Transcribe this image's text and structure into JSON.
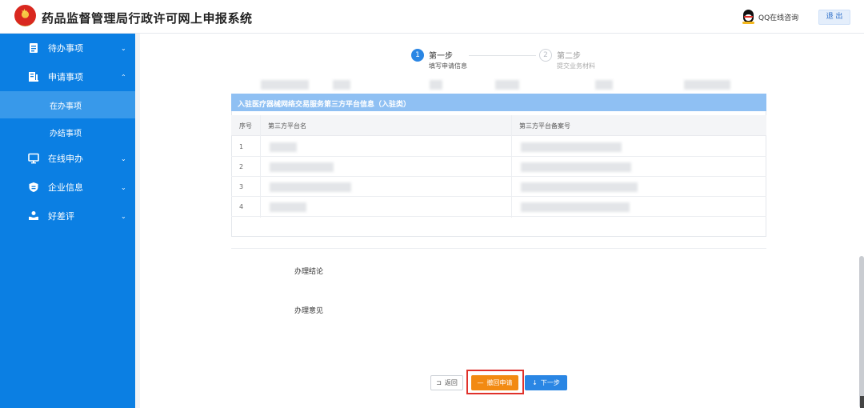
{
  "header": {
    "title": "药品监督管理局行政许可网上申报系统",
    "qq_label": "QQ在线咨询",
    "logout_label": "退 出"
  },
  "sidebar": {
    "items": [
      {
        "label": "待办事项",
        "icon": "todo-list-icon",
        "arrow": "⌄"
      },
      {
        "label": "申请事项",
        "icon": "application-icon",
        "arrow": "⌃"
      },
      {
        "label": "在办事项"
      },
      {
        "label": "办结事项"
      },
      {
        "label": "在线申办",
        "icon": "monitor-icon",
        "arrow": "⌄"
      },
      {
        "label": "企业信息",
        "icon": "shield-icon",
        "arrow": "⌄"
      },
      {
        "label": "好差评",
        "icon": "hand-rating-icon",
        "arrow": "⌄"
      }
    ]
  },
  "steps": [
    {
      "number": "1",
      "title": "第一步",
      "subtitle": "填写申请信息",
      "state": "active"
    },
    {
      "number": "2",
      "title": "第二步",
      "subtitle": "提交业务材料",
      "state": "pending"
    }
  ],
  "table": {
    "title": "入驻医疗器械网络交易服务第三方平台信息（入驻类）",
    "columns": [
      "序号",
      "第三方平台名",
      "第三方平台备案号"
    ],
    "rows": [
      {
        "index": "1"
      },
      {
        "index": "2"
      },
      {
        "index": "3"
      },
      {
        "index": "4"
      }
    ]
  },
  "fields": {
    "conclusion_label": "办理结论",
    "opinion_label": "办理意见"
  },
  "buttons": {
    "back_label": "返回",
    "withdraw_label": "撤回申请",
    "next_label": "下一步"
  },
  "colors": {
    "sidebar": "#0b7fe3",
    "sidebar_active": "#3899ea",
    "primary": "#2a86e4",
    "warning": "#f28a12",
    "highlight": "#e0322b"
  }
}
